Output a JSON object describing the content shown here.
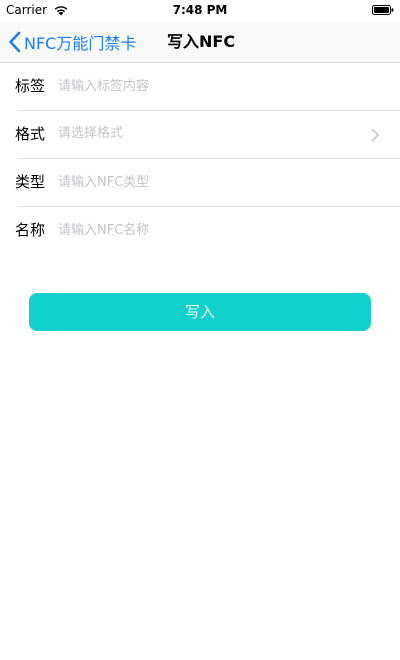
{
  "status_bar": {
    "carrier": "Carrier",
    "time": "7:48 PM"
  },
  "nav": {
    "back_label": "NFC万能门禁卡",
    "title": "写入NFC"
  },
  "form": {
    "rows": [
      {
        "label": "标签",
        "placeholder": "请输入标签内容",
        "kind": "input"
      },
      {
        "label": "格式",
        "placeholder": "请选择格式",
        "kind": "select"
      },
      {
        "label": "类型",
        "placeholder": "请输入NFC类型",
        "kind": "input"
      },
      {
        "label": "名称",
        "placeholder": "请输入NFC名称",
        "kind": "input"
      }
    ]
  },
  "write_button": {
    "label": "写入"
  },
  "colors": {
    "accent_blue": "#1a7ff0",
    "button_teal": "#12d1cc",
    "placeholder_gray": "#c4c4c8",
    "divider_gray": "#e3e3e3"
  },
  "icons": {
    "back": "chevron-left-icon",
    "format_disclosure": "chevron-right-icon",
    "wifi": "wifi-icon",
    "battery": "battery-icon"
  }
}
